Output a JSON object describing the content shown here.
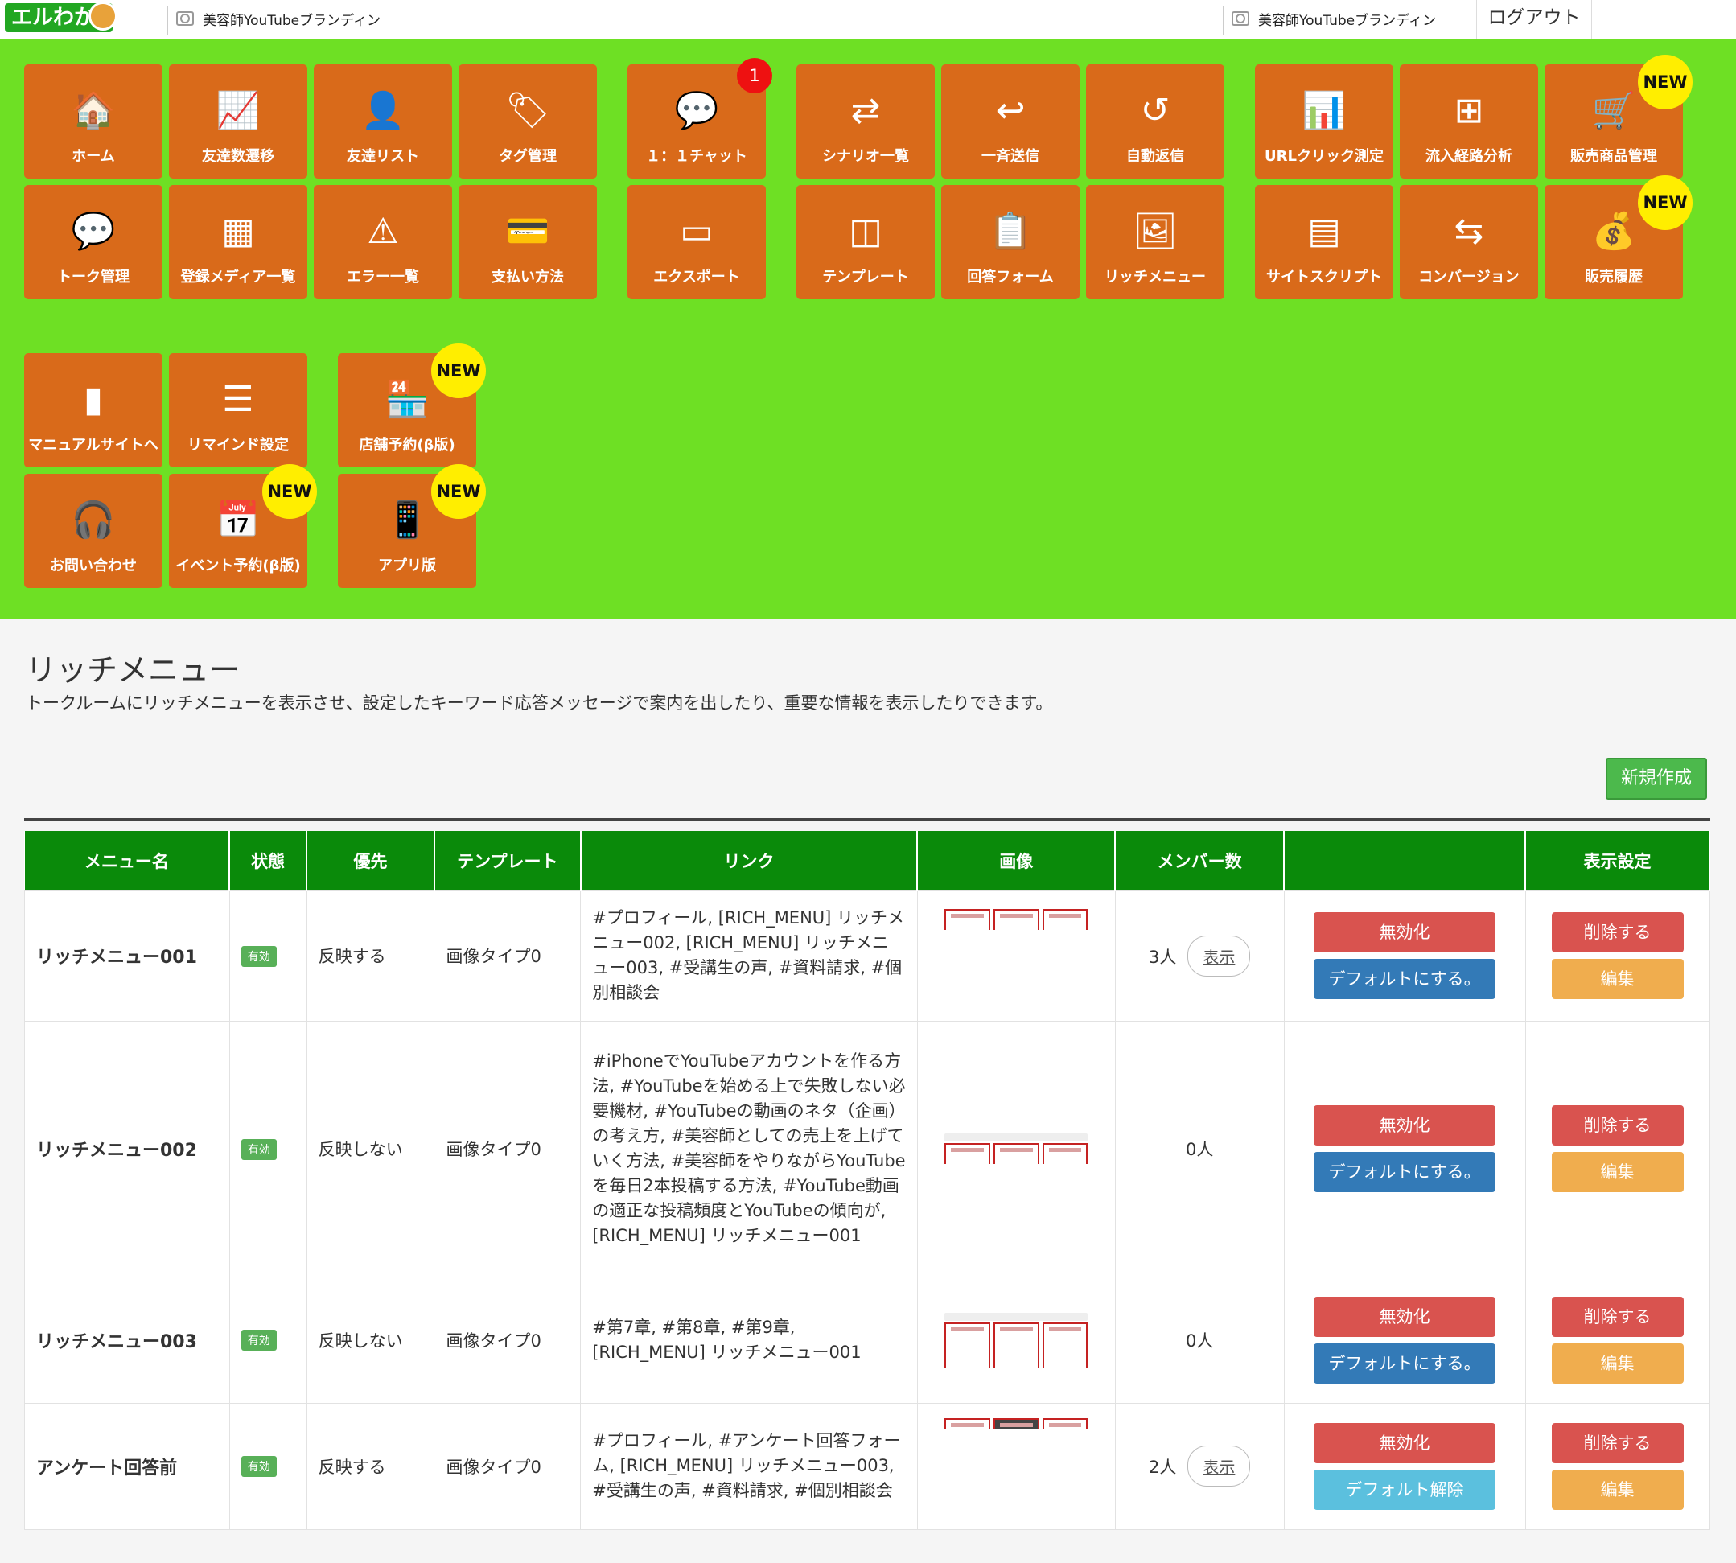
{
  "header": {
    "logo": "エルわか",
    "account_name": "美容師YouTubeブランディン",
    "logout": "ログアウト"
  },
  "nav": {
    "tiles": [
      {
        "label": "ホーム",
        "icon": "🏠"
      },
      {
        "label": "友達数遷移",
        "icon": "📈"
      },
      {
        "label": "友達リスト",
        "icon": "👤"
      },
      {
        "label": "タグ管理",
        "icon": "🏷"
      },
      {
        "label": "１：１チャット",
        "icon": "💬",
        "count": "1"
      },
      {
        "label": "シナリオ一覧",
        "icon": "⇄"
      },
      {
        "label": "一斉送信",
        "icon": "↩"
      },
      {
        "label": "自動返信",
        "icon": "↺"
      },
      {
        "label": "URLクリック測定",
        "icon": "📊"
      },
      {
        "label": "流入経路分析",
        "icon": "⊞"
      },
      {
        "label": "販売商品管理",
        "icon": "🛒",
        "new": "NEW"
      },
      {
        "label": "トーク管理",
        "icon": "💬"
      },
      {
        "label": "登録メディア一覧",
        "icon": "▦"
      },
      {
        "label": "エラー一覧",
        "icon": "⚠"
      },
      {
        "label": "支払い方法",
        "icon": "💳"
      },
      {
        "label": "エクスポート",
        "icon": "▭"
      },
      {
        "label": "テンプレート",
        "icon": "◫"
      },
      {
        "label": "回答フォーム",
        "icon": "📋"
      },
      {
        "label": "リッチメニュー",
        "icon": "🖼"
      },
      {
        "label": "サイトスクリプト",
        "icon": "▤"
      },
      {
        "label": "コンバージョン",
        "icon": "⇆"
      },
      {
        "label": "販売履歴",
        "icon": "💰",
        "new": "NEW"
      },
      {
        "label": "マニュアルサイトへ",
        "icon": "▮"
      },
      {
        "label": "リマインド設定",
        "icon": "☰"
      },
      {
        "label": "店舗予約(β版)",
        "icon": "🏪",
        "new": "NEW"
      },
      {
        "label": "お問い合わせ",
        "icon": "🎧"
      },
      {
        "label": "イベント予約(β版)",
        "icon": "📅",
        "new": "NEW"
      },
      {
        "label": "アプリ版",
        "icon": "📱",
        "new": "NEW"
      }
    ]
  },
  "page": {
    "title": "リッチメニュー",
    "description": "トークルームにリッチメニューを表示させ、設定したキーワード応答メッセージで案内を出したり、重要な情報を表示したりできます。",
    "new_button": "新規作成"
  },
  "table": {
    "headers": [
      "メニュー名",
      "状態",
      "優先",
      "テンプレート",
      "リンク",
      "画像",
      "メンバー数",
      "",
      "表示設定"
    ],
    "rows": [
      {
        "name": "リッチメニュー001",
        "status": "有効",
        "priority": "反映する",
        "template": "画像タイプ0",
        "links": "#プロフィール, [RICH_MENU] リッチメニュー002, [RICH_MENU] リッチメニュー003, #受講生の声, #資料請求, #個別相談会",
        "members": "3人",
        "show": "表示",
        "disable": "無効化",
        "default": "デフォルトにする。",
        "default_style": "blue",
        "delete": "削除する",
        "edit": "編集"
      },
      {
        "name": "リッチメニュー002",
        "status": "有効",
        "priority": "反映しない",
        "template": "画像タイプ0",
        "links": "#iPhoneでYouTubeアカウントを作る方法, #YouTubeを始める上で失敗しない必要機材, #YouTubeの動画のネタ（企画）の考え方, #美容師としての売上を上げていく方法, #美容師をやりながらYouTubeを毎日2本投稿する方法, #YouTube動画の適正な投稿頻度とYouTubeの傾向が, [RICH_MENU] リッチメニュー001",
        "members": "0人",
        "show": "",
        "disable": "無効化",
        "default": "デフォルトにする。",
        "default_style": "blue",
        "delete": "削除する",
        "edit": "編集"
      },
      {
        "name": "リッチメニュー003",
        "status": "有効",
        "priority": "反映しない",
        "template": "画像タイプ0",
        "links": "#第7章, #第8章, #第9章, [RICH_MENU] リッチメニュー001",
        "members": "0人",
        "show": "",
        "disable": "無効化",
        "default": "デフォルトにする。",
        "default_style": "blue",
        "delete": "削除する",
        "edit": "編集"
      },
      {
        "name": "アンケート回答前",
        "status": "有効",
        "priority": "反映する",
        "template": "画像タイプ0",
        "links": "#プロフィール, #アンケート回答フォーム, [RICH_MENU] リッチメニュー003, #受講生の声, #資料請求, #個別相談会",
        "members": "2人",
        "show": "表示",
        "disable": "無効化",
        "default": "デフォルト解除",
        "default_style": "cyan",
        "delete": "削除する",
        "edit": "編集"
      }
    ]
  }
}
